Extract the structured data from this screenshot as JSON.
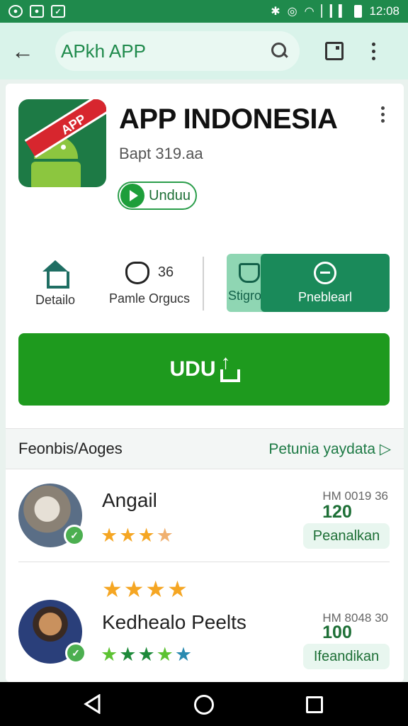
{
  "status_bar": {
    "time": "12:08",
    "icons": [
      "sync-icon",
      "image-icon",
      "check-icon",
      "bluetooth-icon",
      "vibrate-icon",
      "wifi-icon",
      "signal-icon",
      "battery-icon"
    ]
  },
  "toolbar": {
    "search_text": "APkh APP"
  },
  "app": {
    "title": "APP INDONESIA",
    "subtitle": "Bapt 319.aa",
    "chip_label": "Unduu",
    "icon_ribbon": "APP"
  },
  "actions": {
    "detail_label": "Detailo",
    "count": "36",
    "second_label": "Pamle Orgucs",
    "seg_a_label": "Stigrols",
    "seg_b_label": "Pneblearl"
  },
  "main_button": {
    "label": "UDU"
  },
  "section": {
    "title": "Feonbis/Aoges",
    "link": "Petunia yaydata ▷"
  },
  "reviews": [
    {
      "name": "Angail",
      "meta": "HM 0019 36",
      "count": "120",
      "button": "Peanalkan",
      "rating": 3.5
    },
    {
      "name": "Kedhealo Peelts",
      "meta": "HM 8048 30",
      "count": "100",
      "button": "Ifeandikan",
      "rating": 5
    }
  ],
  "colors": {
    "status_bar": "#1f8a4c",
    "toolbar": "#d9f3ea",
    "primary_button": "#1e9a1e",
    "accent_dark": "#1a8a5a",
    "star_orange": "#f5a623"
  }
}
